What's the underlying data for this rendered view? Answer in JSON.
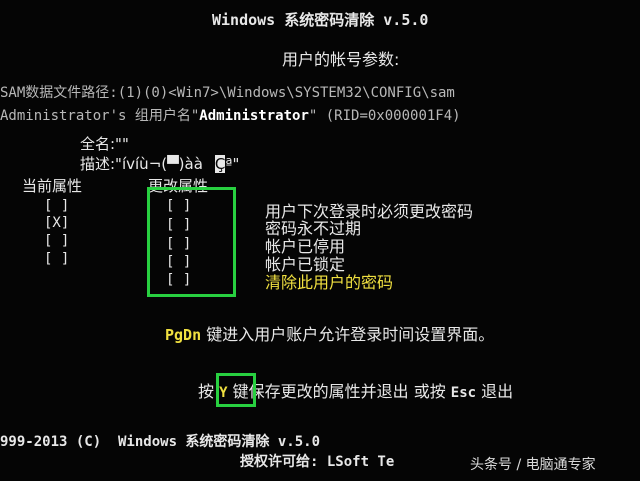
{
  "title": "Windows 系统密码清除 v.5.0",
  "section_title": "用户的帐号参数:",
  "sam_path": "SAM数据文件路径:(1)(0)<Win7>\\Windows\\SYSTEM32\\CONFIG\\sam",
  "admin_line": {
    "prefix": "Administrator's 组用户名\"",
    "name": "Administrator",
    "suffix": "\" (RID=0x000001F4)"
  },
  "fullname": "全名:\"\"",
  "description": {
    "label": "描述:\"",
    "value": "ívíù¬(▀)àà",
    "cursor_char": "Ç",
    "tail": "ª\""
  },
  "current_attr_header": "当前属性",
  "change_attr_header": "更改属性",
  "current_attrs": [
    "[ ]",
    "[X]",
    "[ ]",
    "[ ]"
  ],
  "change_attrs": [
    "[ ]",
    "[ ]",
    "[ ]",
    "[ ]",
    "[ ]"
  ],
  "attr_labels": [
    "用户下次登录时必须更改密码",
    "密码永不过期",
    "帐户已停用",
    "帐户已锁定",
    "清除此用户的密码"
  ],
  "pgdn": {
    "key": "PgDn",
    "text": " 键进入用户账户允许登录时间设置界面。"
  },
  "save_line": {
    "prefix": "按 ",
    "key": "Y",
    "mid": " 键保存更改的属性并退出 或按 ",
    "esc": "Esc",
    "suffix": " 退出"
  },
  "footer_line1": "999-2013 (C)  Windows 系统密码清除 v.5.0",
  "footer_line2": "授权许可给: LSoft Te",
  "watermark": "头条号 / 电脑通专家",
  "colors": {
    "background": "#050505",
    "text": "#e8e8e8",
    "highlight": "#f0e040",
    "box": "#28d040"
  }
}
